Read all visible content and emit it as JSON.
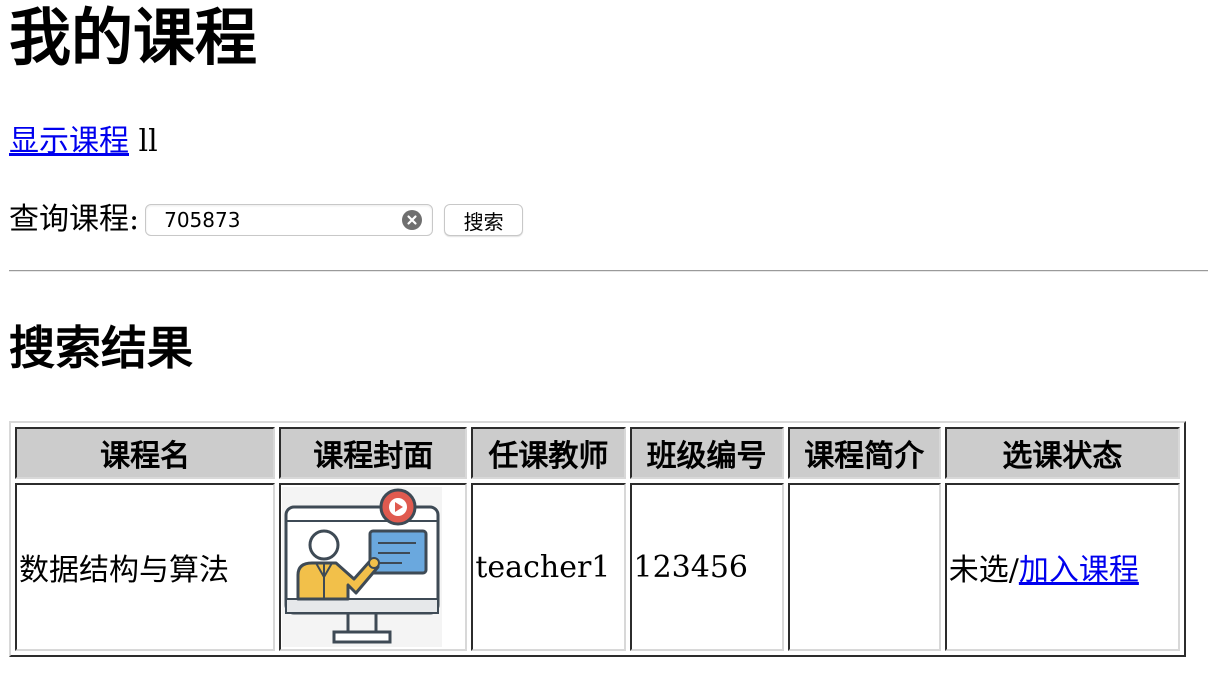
{
  "page": {
    "title": "我的课程"
  },
  "nav": {
    "show_courses_link": "显示课程",
    "separator": "ll"
  },
  "search": {
    "label": "查询课程:",
    "value": "705873",
    "button_label": "搜索"
  },
  "results": {
    "title": "搜索结果",
    "columns": [
      "课程名",
      "课程封面",
      "任课教师",
      "班级编号",
      "课程简介",
      "选课状态"
    ],
    "rows": [
      {
        "course_name": "数据结构与算法",
        "cover_icon": "teacher-presentation-icon",
        "teacher": "teacher1",
        "class_id": "123456",
        "description": "",
        "status_text": "未选/",
        "action_link": "加入课程"
      }
    ]
  },
  "colors": {
    "link": "#0000ee",
    "header_bg": "#cccccc",
    "cover_accent_red": "#e05a4f",
    "cover_accent_blue": "#6aa8de",
    "cover_accent_yellow": "#f2c04a",
    "cover_outline": "#3e4a55"
  }
}
